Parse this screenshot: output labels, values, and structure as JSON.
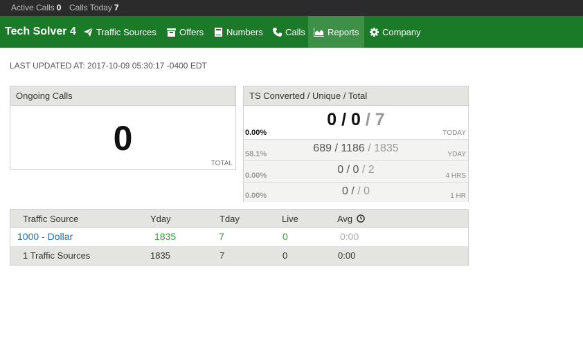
{
  "statusbar": {
    "active_calls_label": "Active Calls",
    "active_calls_value": "0",
    "calls_today_label": "Calls Today",
    "calls_today_value": "7"
  },
  "nav": {
    "brand": "Tech Solver 4",
    "items": [
      {
        "label": "Traffic Sources",
        "icon": "paper-plane-icon"
      },
      {
        "label": "Offers",
        "icon": "box-icon"
      },
      {
        "label": "Numbers",
        "icon": "book-icon"
      },
      {
        "label": "Calls",
        "icon": "phone-icon"
      },
      {
        "label": "Reports",
        "icon": "area-chart-icon",
        "active": true
      },
      {
        "label": "Company",
        "icon": "gear-icon"
      }
    ]
  },
  "last_updated": "LAST UPDATED AT: 2017-10-09 05:30:17 -0400 EDT",
  "ongoing": {
    "title": "Ongoing Calls",
    "value": "0",
    "footer": "TOTAL"
  },
  "ts_converted": {
    "title": "TS Converted / Unique / Total",
    "rows": [
      {
        "pct": "0.00%",
        "converted": "0",
        "unique": "0",
        "total": "7",
        "label": "TODAY"
      },
      {
        "pct": "58.1%",
        "converted": "689",
        "unique": "1186",
        "total": "1835",
        "label": "YDAY"
      },
      {
        "pct": "0.00%",
        "converted": "0",
        "unique": "0",
        "total": "2",
        "label": "4 HRS"
      },
      {
        "pct": "0.00%",
        "converted": "0",
        "unique": "",
        "total": "0",
        "label": "1 HR"
      }
    ]
  },
  "table": {
    "headers": [
      "Traffic Source",
      "Yday",
      "Tday",
      "Live",
      "Avg"
    ],
    "rows": [
      {
        "source": "1000 - Dollar",
        "yday": "1835",
        "tday": "7",
        "live": "0",
        "avg": "0:00"
      }
    ],
    "footer": {
      "source": "1 Traffic Sources",
      "yday": "1835",
      "tday": "7",
      "live": "0",
      "avg": "0:00"
    }
  },
  "colors": {
    "navbar": "#1a7a27",
    "nav_active": "#3e8f48",
    "statusbar": "#2b2b2b",
    "link": "#1f6fa8",
    "positive": "#3a9a3a"
  }
}
